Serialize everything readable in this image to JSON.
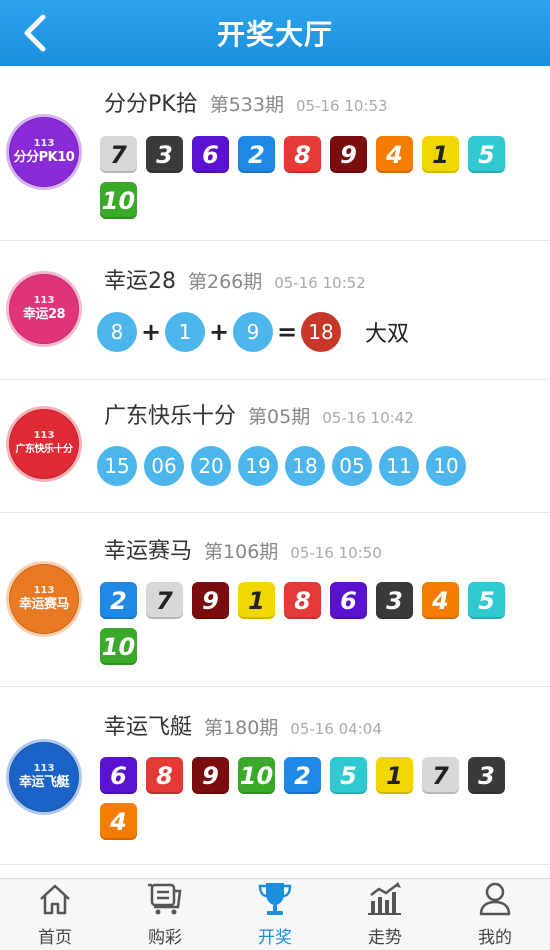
{
  "header": {
    "title": "开奖大厅",
    "back_icon": "chevron-left-icon"
  },
  "lotteries": [
    {
      "name": "分分PK拾",
      "issue": "第533期",
      "time": "05-16 10:53",
      "logo": {
        "num": "113",
        "text": "分分PK10",
        "color": "#8a2bd8"
      },
      "balls": [
        {
          "v": "7",
          "c": "#d8d8d8"
        },
        {
          "v": "3",
          "c": "#3a3a3a"
        },
        {
          "v": "6",
          "c": "#5a12d0"
        },
        {
          "v": "2",
          "c": "#1e88e5"
        },
        {
          "v": "8",
          "c": "#e53935"
        },
        {
          "v": "9",
          "c": "#7a0e0e"
        },
        {
          "v": "4",
          "c": "#f57c00"
        },
        {
          "v": "1",
          "c": "#f2d600"
        },
        {
          "v": "5",
          "c": "#2ecad0"
        },
        {
          "v": "10",
          "c": "#3aa829"
        }
      ]
    },
    {
      "name": "幸运28",
      "issue": "第266期",
      "time": "05-16 10:52",
      "logo": {
        "num": "113",
        "text": "幸运28",
        "color": "#e0347a"
      },
      "numbers": [
        "8",
        "1",
        "9"
      ],
      "ops": [
        "+",
        "+",
        "="
      ],
      "sum": "18",
      "result": "大双"
    },
    {
      "name": "广东快乐十分",
      "issue": "第05期",
      "time": "05-16 10:42",
      "logo": {
        "num": "113",
        "text": "广东快乐十分",
        "color": "#e02a36"
      },
      "numbers": [
        "15",
        "06",
        "20",
        "19",
        "18",
        "05",
        "11",
        "10"
      ]
    },
    {
      "name": "幸运赛马",
      "issue": "第106期",
      "time": "05-16 10:50",
      "logo": {
        "num": "113",
        "text": "幸运赛马",
        "color": "#ea7a22"
      },
      "balls": [
        {
          "v": "2",
          "c": "#1e88e5"
        },
        {
          "v": "7",
          "c": "#d8d8d8"
        },
        {
          "v": "9",
          "c": "#7a0e0e"
        },
        {
          "v": "1",
          "c": "#f2d600"
        },
        {
          "v": "8",
          "c": "#e53935"
        },
        {
          "v": "6",
          "c": "#5a12d0"
        },
        {
          "v": "3",
          "c": "#3a3a3a"
        },
        {
          "v": "4",
          "c": "#f57c00"
        },
        {
          "v": "5",
          "c": "#2ecad0"
        },
        {
          "v": "10",
          "c": "#3aa829"
        }
      ]
    },
    {
      "name": "幸运飞艇",
      "issue": "第180期",
      "time": "05-16 04:04",
      "logo": {
        "num": "113",
        "text": "幸运飞艇",
        "color": "#1c63c8"
      },
      "balls": [
        {
          "v": "6",
          "c": "#5a12d0"
        },
        {
          "v": "8",
          "c": "#e53935"
        },
        {
          "v": "9",
          "c": "#7a0e0e"
        },
        {
          "v": "10",
          "c": "#3aa829"
        },
        {
          "v": "2",
          "c": "#1e88e5"
        },
        {
          "v": "5",
          "c": "#2ecad0"
        },
        {
          "v": "1",
          "c": "#f2d600"
        },
        {
          "v": "7",
          "c": "#d8d8d8"
        },
        {
          "v": "3",
          "c": "#3a3a3a"
        },
        {
          "v": "4",
          "c": "#f57c00"
        }
      ]
    }
  ],
  "tabbar": {
    "items": [
      {
        "label": "首页",
        "icon": "home-icon"
      },
      {
        "label": "购彩",
        "icon": "cart-icon"
      },
      {
        "label": "开奖",
        "icon": "trophy-icon",
        "active": true
      },
      {
        "label": "走势",
        "icon": "chart-icon"
      },
      {
        "label": "我的",
        "icon": "user-icon"
      }
    ]
  }
}
